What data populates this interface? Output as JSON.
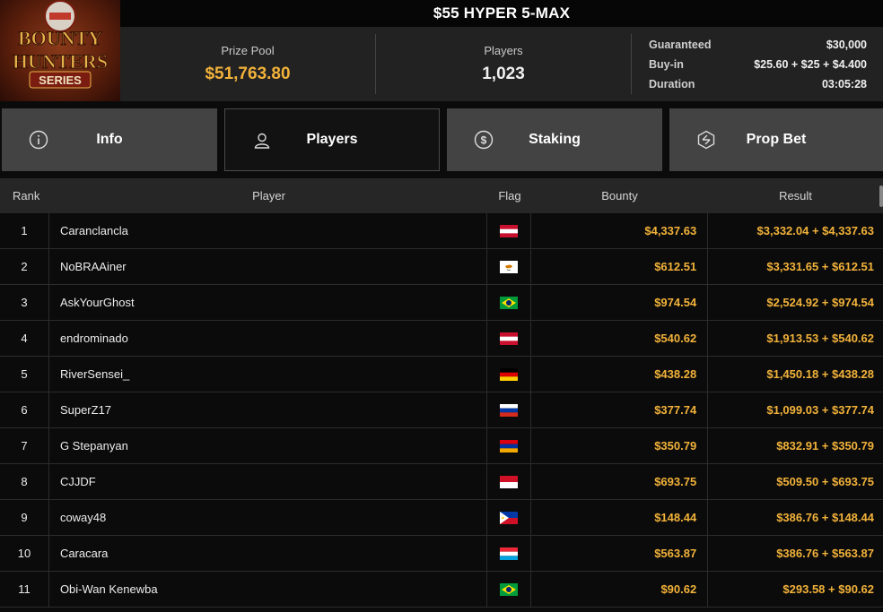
{
  "logo": {
    "line1": "BOUNTY",
    "line2": "HUNTERS",
    "line3": "SERIES"
  },
  "title": "$55 HYPER 5-MAX",
  "stats": {
    "prize_pool_label": "Prize Pool",
    "prize_pool_value": "$51,763.80",
    "players_label": "Players",
    "players_value": "1,023",
    "details": [
      {
        "key": "Guaranteed",
        "value": "$30,000"
      },
      {
        "key": "Buy-in",
        "value": "$25.60 + $25 + $4.400"
      },
      {
        "key": "Duration",
        "value": "03:05:28"
      }
    ]
  },
  "tabs": [
    {
      "label": "Info",
      "icon": "info-icon",
      "active": false
    },
    {
      "label": "Players",
      "icon": "user-icon",
      "active": true
    },
    {
      "label": "Staking",
      "icon": "dollar-coin-icon",
      "active": false
    },
    {
      "label": "Prop Bet",
      "icon": "prop-bet-icon",
      "active": false
    }
  ],
  "table": {
    "headers": {
      "rank": "Rank",
      "player": "Player",
      "flag": "Flag",
      "bounty": "Bounty",
      "result": "Result"
    },
    "rows": [
      {
        "rank": "1",
        "player": "Caranclancla",
        "flag": "austria",
        "bounty": "$4,337.63",
        "result": "$3,332.04 + $4,337.63"
      },
      {
        "rank": "2",
        "player": "NoBRAAiner",
        "flag": "cyprus",
        "bounty": "$612.51",
        "result": "$3,331.65 + $612.51"
      },
      {
        "rank": "3",
        "player": "AskYourGhost",
        "flag": "brazil",
        "bounty": "$974.54",
        "result": "$2,524.92 + $974.54"
      },
      {
        "rank": "4",
        "player": "endrominado",
        "flag": "austria",
        "bounty": "$540.62",
        "result": "$1,913.53 + $540.62"
      },
      {
        "rank": "5",
        "player": "RiverSensei_",
        "flag": "germany",
        "bounty": "$438.28",
        "result": "$1,450.18 + $438.28"
      },
      {
        "rank": "6",
        "player": "SuperZ17",
        "flag": "russia",
        "bounty": "$377.74",
        "result": "$1,099.03 + $377.74"
      },
      {
        "rank": "7",
        "player": "G Stepanyan",
        "flag": "armenia",
        "bounty": "$350.79",
        "result": "$832.91 + $350.79"
      },
      {
        "rank": "8",
        "player": "CJJDF",
        "flag": "indonesia",
        "bounty": "$693.75",
        "result": "$509.50 + $693.75"
      },
      {
        "rank": "9",
        "player": "coway48",
        "flag": "philippines",
        "bounty": "$148.44",
        "result": "$386.76 + $148.44"
      },
      {
        "rank": "10",
        "player": "Caracara",
        "flag": "luxembourg",
        "bounty": "$563.87",
        "result": "$386.76 + $563.87"
      },
      {
        "rank": "11",
        "player": "Obi-Wan Kenewba",
        "flag": "brazil",
        "bounty": "$90.62",
        "result": "$293.58 + $90.62"
      }
    ]
  },
  "colors": {
    "accent": "#f2b23a",
    "tab_inactive": "#434343",
    "tab_active": "#121212"
  }
}
